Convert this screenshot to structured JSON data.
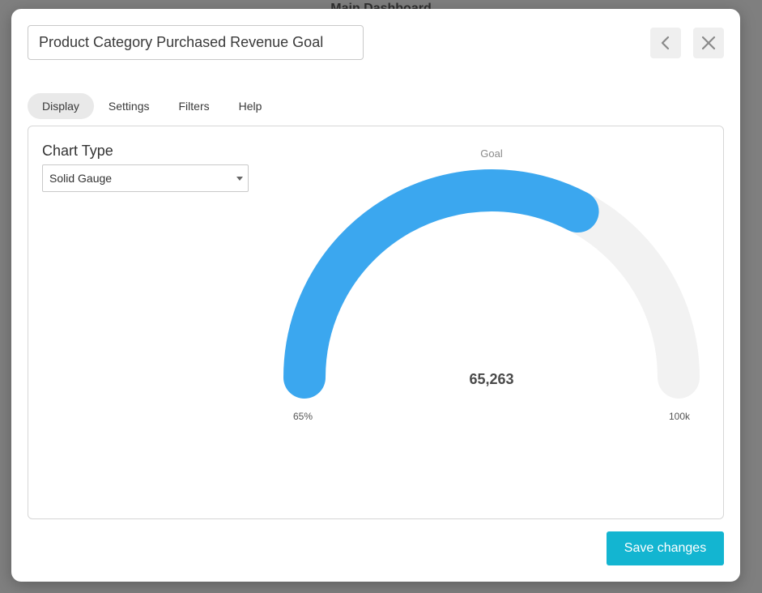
{
  "backdrop": {
    "title": "Main Dashboard"
  },
  "modal": {
    "title_value": "Product Category Purchased Revenue Goal",
    "tabs": [
      {
        "label": "Display",
        "active": true
      },
      {
        "label": "Settings",
        "active": false
      },
      {
        "label": "Filters",
        "active": false
      },
      {
        "label": "Help",
        "active": false
      }
    ],
    "chart_type_label": "Chart Type",
    "chart_type_selected": "Solid Gauge",
    "save_label": "Save changes",
    "icons": {
      "back": "chevron-left-icon",
      "close": "close-icon",
      "select": "caret-down-icon"
    }
  },
  "chart_data": {
    "type": "solid-gauge",
    "title": "Goal",
    "value": 65263,
    "value_label": "65,263",
    "min": 0,
    "max": 100000,
    "min_label": "65%",
    "max_label": "100k",
    "colors": {
      "fill": "#3ba7ef",
      "track": "#f2f2f2"
    }
  }
}
